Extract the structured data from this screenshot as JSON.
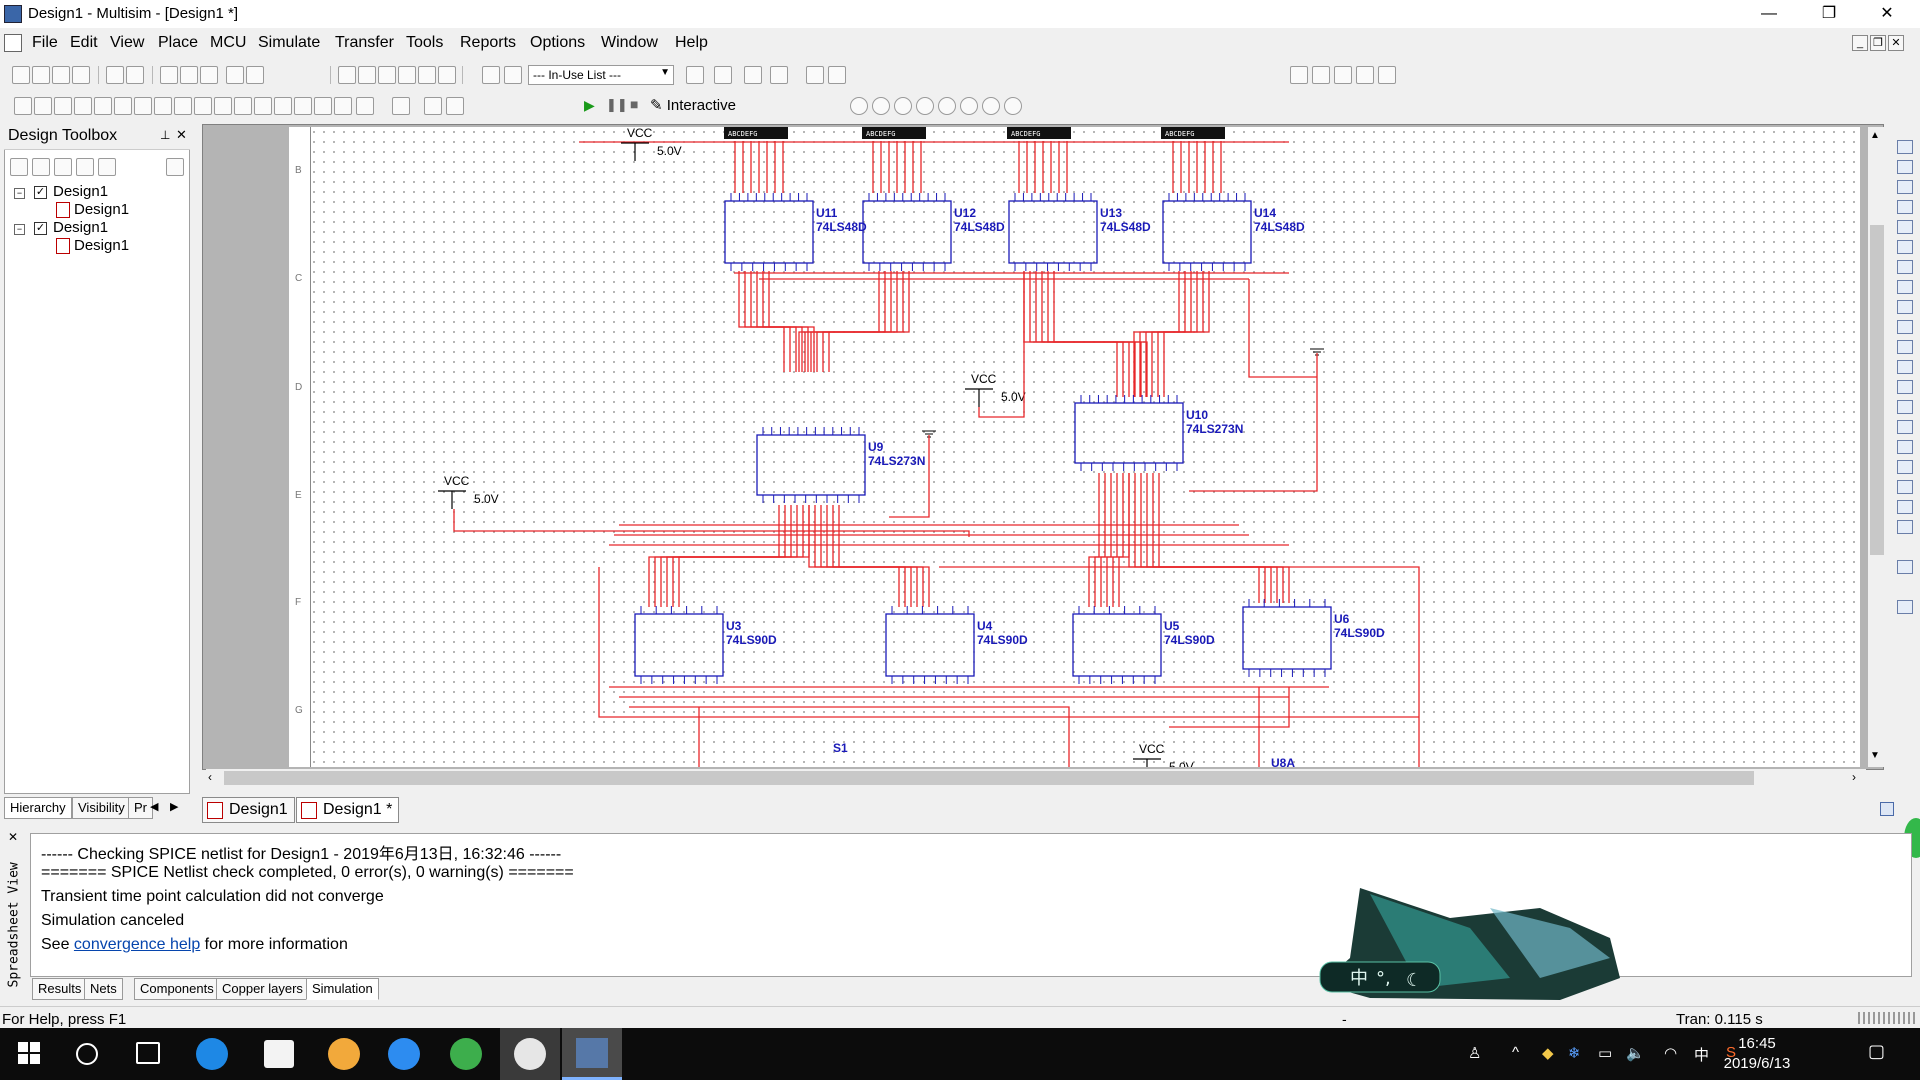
{
  "window": {
    "title": "Design1 - Multisim - [Design1 *]",
    "minimize": "—",
    "restore": "❐",
    "close": "✕"
  },
  "menu": [
    "File",
    "Edit",
    "View",
    "Place",
    "MCU",
    "Simulate",
    "Transfer",
    "Tools",
    "Reports",
    "Options",
    "Window",
    "Help"
  ],
  "toolbar": {
    "inuse_list": "--- In-Use List ---",
    "interactive_label": "Interactive"
  },
  "toolbox": {
    "title": "Design Toolbox",
    "tree": [
      {
        "label": "Design1",
        "child": "Design1"
      },
      {
        "label": "Design1",
        "child": "Design1"
      }
    ],
    "tabs": [
      "Hierarchy",
      "Visibility",
      "Pr"
    ]
  },
  "doc_tabs": [
    "Design1",
    "Design1 *"
  ],
  "schematic": {
    "displays": [
      "ABCDEFG",
      "ABCDEFG",
      "ABCDEFG",
      "ABCDEFG"
    ],
    "decoders": [
      {
        "ref": "U11",
        "part": "74LS48D"
      },
      {
        "ref": "U12",
        "part": "74LS48D"
      },
      {
        "ref": "U13",
        "part": "74LS48D"
      },
      {
        "ref": "U14",
        "part": "74LS48D"
      }
    ],
    "latches": [
      {
        "ref": "U9",
        "part": "74LS273N"
      },
      {
        "ref": "U10",
        "part": "74LS273N"
      }
    ],
    "counters": [
      {
        "ref": "U3",
        "part": "74LS90D"
      },
      {
        "ref": "U4",
        "part": "74LS90D"
      },
      {
        "ref": "U5",
        "part": "74LS90D"
      },
      {
        "ref": "U6",
        "part": "74LS90D"
      }
    ],
    "vcc": [
      {
        "name": "VCC",
        "value": "5.0V"
      },
      {
        "name": "VCC",
        "value": "5.0V"
      },
      {
        "name": "VCC",
        "value": "5.0V"
      },
      {
        "name": "VCC",
        "value": "5.0V"
      }
    ],
    "switch_label": "S1",
    "partial_label": "U8A",
    "ruler_letters": [
      "B",
      "C",
      "D",
      "E",
      "F",
      "G"
    ],
    "colors": {
      "wire": "#e8262a",
      "component": "#1a1ab8"
    }
  },
  "output": {
    "lines": [
      "------ Checking SPICE netlist for Design1 - 2019年6月13日, 16:32:46 ------",
      "======= SPICE Netlist check completed, 0 error(s), 0 warning(s) =======",
      "Transient time point calculation did not converge",
      "Simulation canceled"
    ],
    "help_prefix": "See ",
    "help_link": "convergence help",
    "help_suffix": " for more information",
    "side_label": "Spreadsheet View",
    "tabs": [
      "Results",
      "Nets",
      "Components",
      "Copper layers",
      "Simulation"
    ]
  },
  "status": {
    "help": "For Help, press F1",
    "middle": "-",
    "tran": "Tran: 0.115 s"
  },
  "taskbar": {
    "time": "16:45",
    "date": "2019/6/13",
    "ime": "中"
  }
}
